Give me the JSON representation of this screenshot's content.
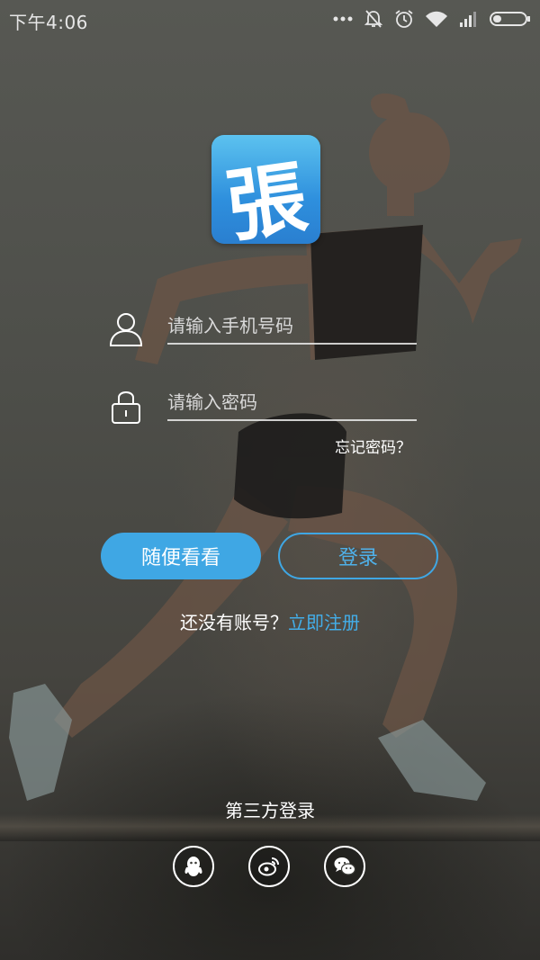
{
  "status_bar": {
    "time": "下午4:06",
    "icons": [
      "more-dots-icon",
      "mute-icon",
      "alarm-icon",
      "wifi-icon",
      "signal-icon",
      "battery-icon"
    ]
  },
  "logo": {
    "glyph": "張",
    "colors": {
      "top": "#5cc2ef",
      "bottom": "#2a7fd0"
    }
  },
  "login_form": {
    "phone": {
      "placeholder": "请输入手机号码",
      "value": "",
      "icon": "user-icon"
    },
    "password": {
      "placeholder": "请输入密码",
      "value": "",
      "icon": "lock-icon"
    },
    "forgot_password": "忘记密码？"
  },
  "actions": {
    "browse_label": "随便看看",
    "login_label": "登录",
    "accent_color": "#3fa7e4"
  },
  "register": {
    "prompt": "还没有账号？",
    "link": "立即注册"
  },
  "third_party": {
    "title": "第三方登录",
    "providers": [
      "qq-icon",
      "weibo-icon",
      "wechat-icon"
    ]
  }
}
